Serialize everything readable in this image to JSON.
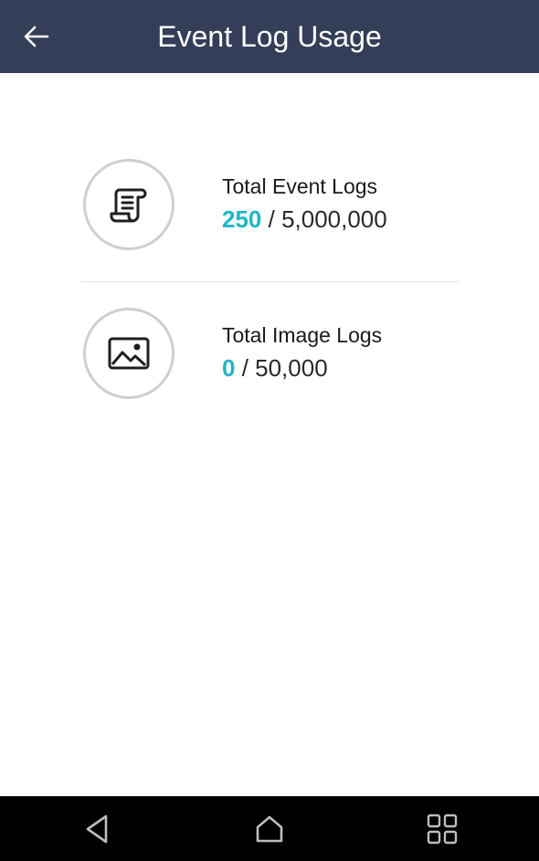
{
  "header": {
    "title": "Event Log Usage",
    "back_icon": "arrow-left-icon"
  },
  "stats": [
    {
      "label": "Total Event Logs",
      "used": "250",
      "separator": " / ",
      "limit": "5,000,000",
      "icon": "scroll-document-icon"
    },
    {
      "label": "Total Image Logs",
      "used": "0",
      "separator": " / ",
      "limit": "50,000",
      "icon": "image-icon"
    }
  ],
  "navbar": {
    "back_icon": "triangle-back-icon",
    "home_icon": "home-icon",
    "recent_icon": "grid-recent-apps-icon"
  },
  "colors": {
    "header_bg": "#353e58",
    "accent": "#1fb6c5",
    "circle_border": "#cfcfcf",
    "navbar_bg": "#000000"
  }
}
